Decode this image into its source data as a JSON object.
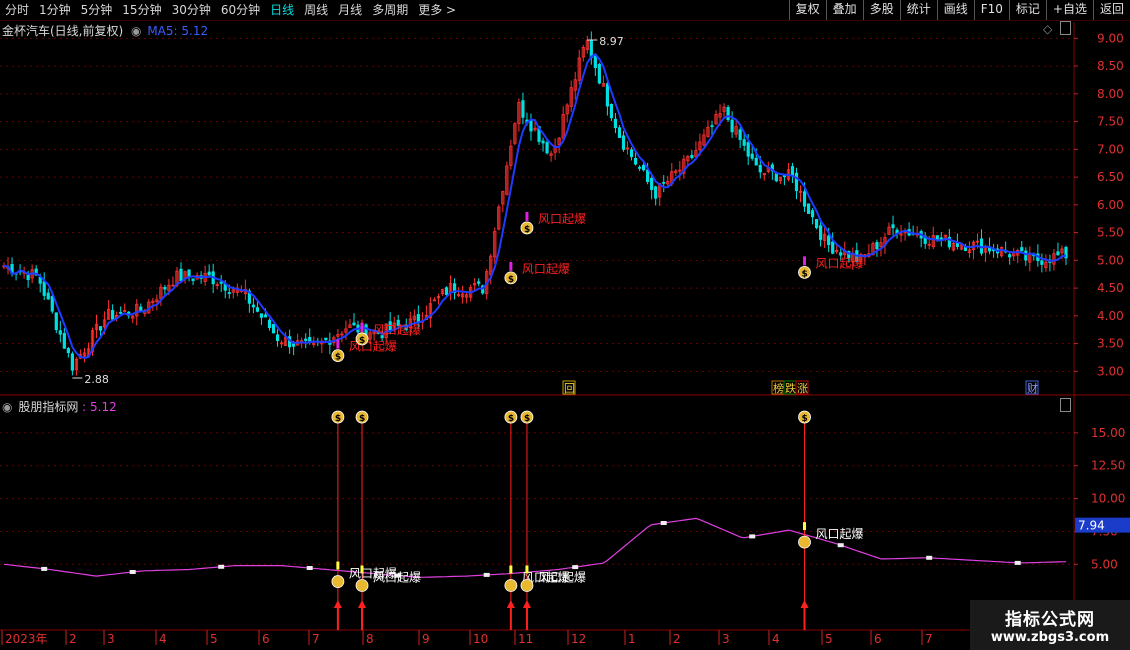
{
  "toolbar": {
    "periods": [
      "分时",
      "1分钟",
      "5分钟",
      "15分钟",
      "30分钟",
      "60分钟",
      "日线",
      "周线",
      "月线",
      "多周期",
      "更多 >"
    ],
    "active_period": "日线",
    "buttons": [
      "复权",
      "叠加",
      "多股",
      "统计",
      "画线",
      "F10",
      "标记",
      "+自选",
      "返回"
    ]
  },
  "main_panel": {
    "title": "金杯汽车(日线,前复权)",
    "ma_label": "MA5: 5.12",
    "high_label": "8.97",
    "low_label": "2.88",
    "signal_label": "风口起爆",
    "y_ticks": [
      "9.00",
      "8.50",
      "8.00",
      "7.50",
      "7.00",
      "6.50",
      "6.00",
      "5.50",
      "5.00",
      "4.50",
      "4.00",
      "3.50",
      "3.00"
    ],
    "badges": [
      "回",
      "榜",
      "跌",
      "涨",
      "财"
    ]
  },
  "sub_panel": {
    "title": "股朋指标网",
    "value_label": ": 5.12",
    "current_value": "7.94",
    "signal_label": "风口起爆",
    "y_ticks": [
      "15.00",
      "12.50",
      "10.00",
      "7.50",
      "5.00"
    ]
  },
  "time_axis": {
    "labels": [
      "2023年",
      "2",
      "3",
      "4",
      "5",
      "6",
      "7",
      "8",
      "9",
      "10",
      "11",
      "12",
      "1",
      "2",
      "3",
      "4",
      "5",
      "6",
      "7"
    ]
  },
  "watermark": {
    "line1": "指标公式网",
    "line2": "www.zbgs3.com"
  },
  "colors": {
    "up": "#ff3030",
    "down": "#00e0e0",
    "ma": "#1e3cff",
    "signal": "#ff2020",
    "indicator_line": "#e040e0",
    "grid": "#6a0000"
  },
  "chart_data": [
    {
      "type": "candlestick",
      "title": "金杯汽车(日线,前复权)",
      "ylim": [
        2.7,
        9.15
      ],
      "x_periods": [
        "2023-01",
        "2023-02",
        "2023-03",
        "2023-04",
        "2023-05",
        "2023-06",
        "2023-07",
        "2023-08",
        "2023-09",
        "2023-10",
        "2023-11",
        "2023-12",
        "2024-01",
        "2024-02",
        "2024-03",
        "2024-04",
        "2024-05",
        "2024-06",
        "2024-07"
      ],
      "approx_close_path": [
        4.9,
        4.7,
        3.1,
        4.0,
        4.1,
        4.7,
        4.7,
        4.4,
        3.6,
        3.4,
        3.8,
        3.7,
        3.9,
        4.5,
        4.5,
        7.8,
        6.9,
        8.97,
        7.2,
        6.2,
        6.8,
        7.7,
        6.6,
        6.5,
        5.3,
        5.0,
        5.6,
        5.4,
        5.3,
        5.2,
        5.0,
        5.1
      ],
      "annotations": [
        {
          "text": "8.97"
        },
        {
          "text": "2.88"
        },
        {
          "text": "风口起爆"
        }
      ]
    },
    {
      "type": "line",
      "title": "股朋指标网",
      "ylim": [
        0,
        17.5
      ],
      "approx_values": [
        5.0,
        4.6,
        4.1,
        4.5,
        4.6,
        4.9,
        4.9,
        4.6,
        4.3,
        4.0,
        4.1,
        4.3,
        4.6,
        5.1,
        8.0,
        8.5,
        7.0,
        7.6,
        6.6,
        5.4,
        5.5,
        5.3,
        5.1,
        5.2
      ]
    }
  ]
}
